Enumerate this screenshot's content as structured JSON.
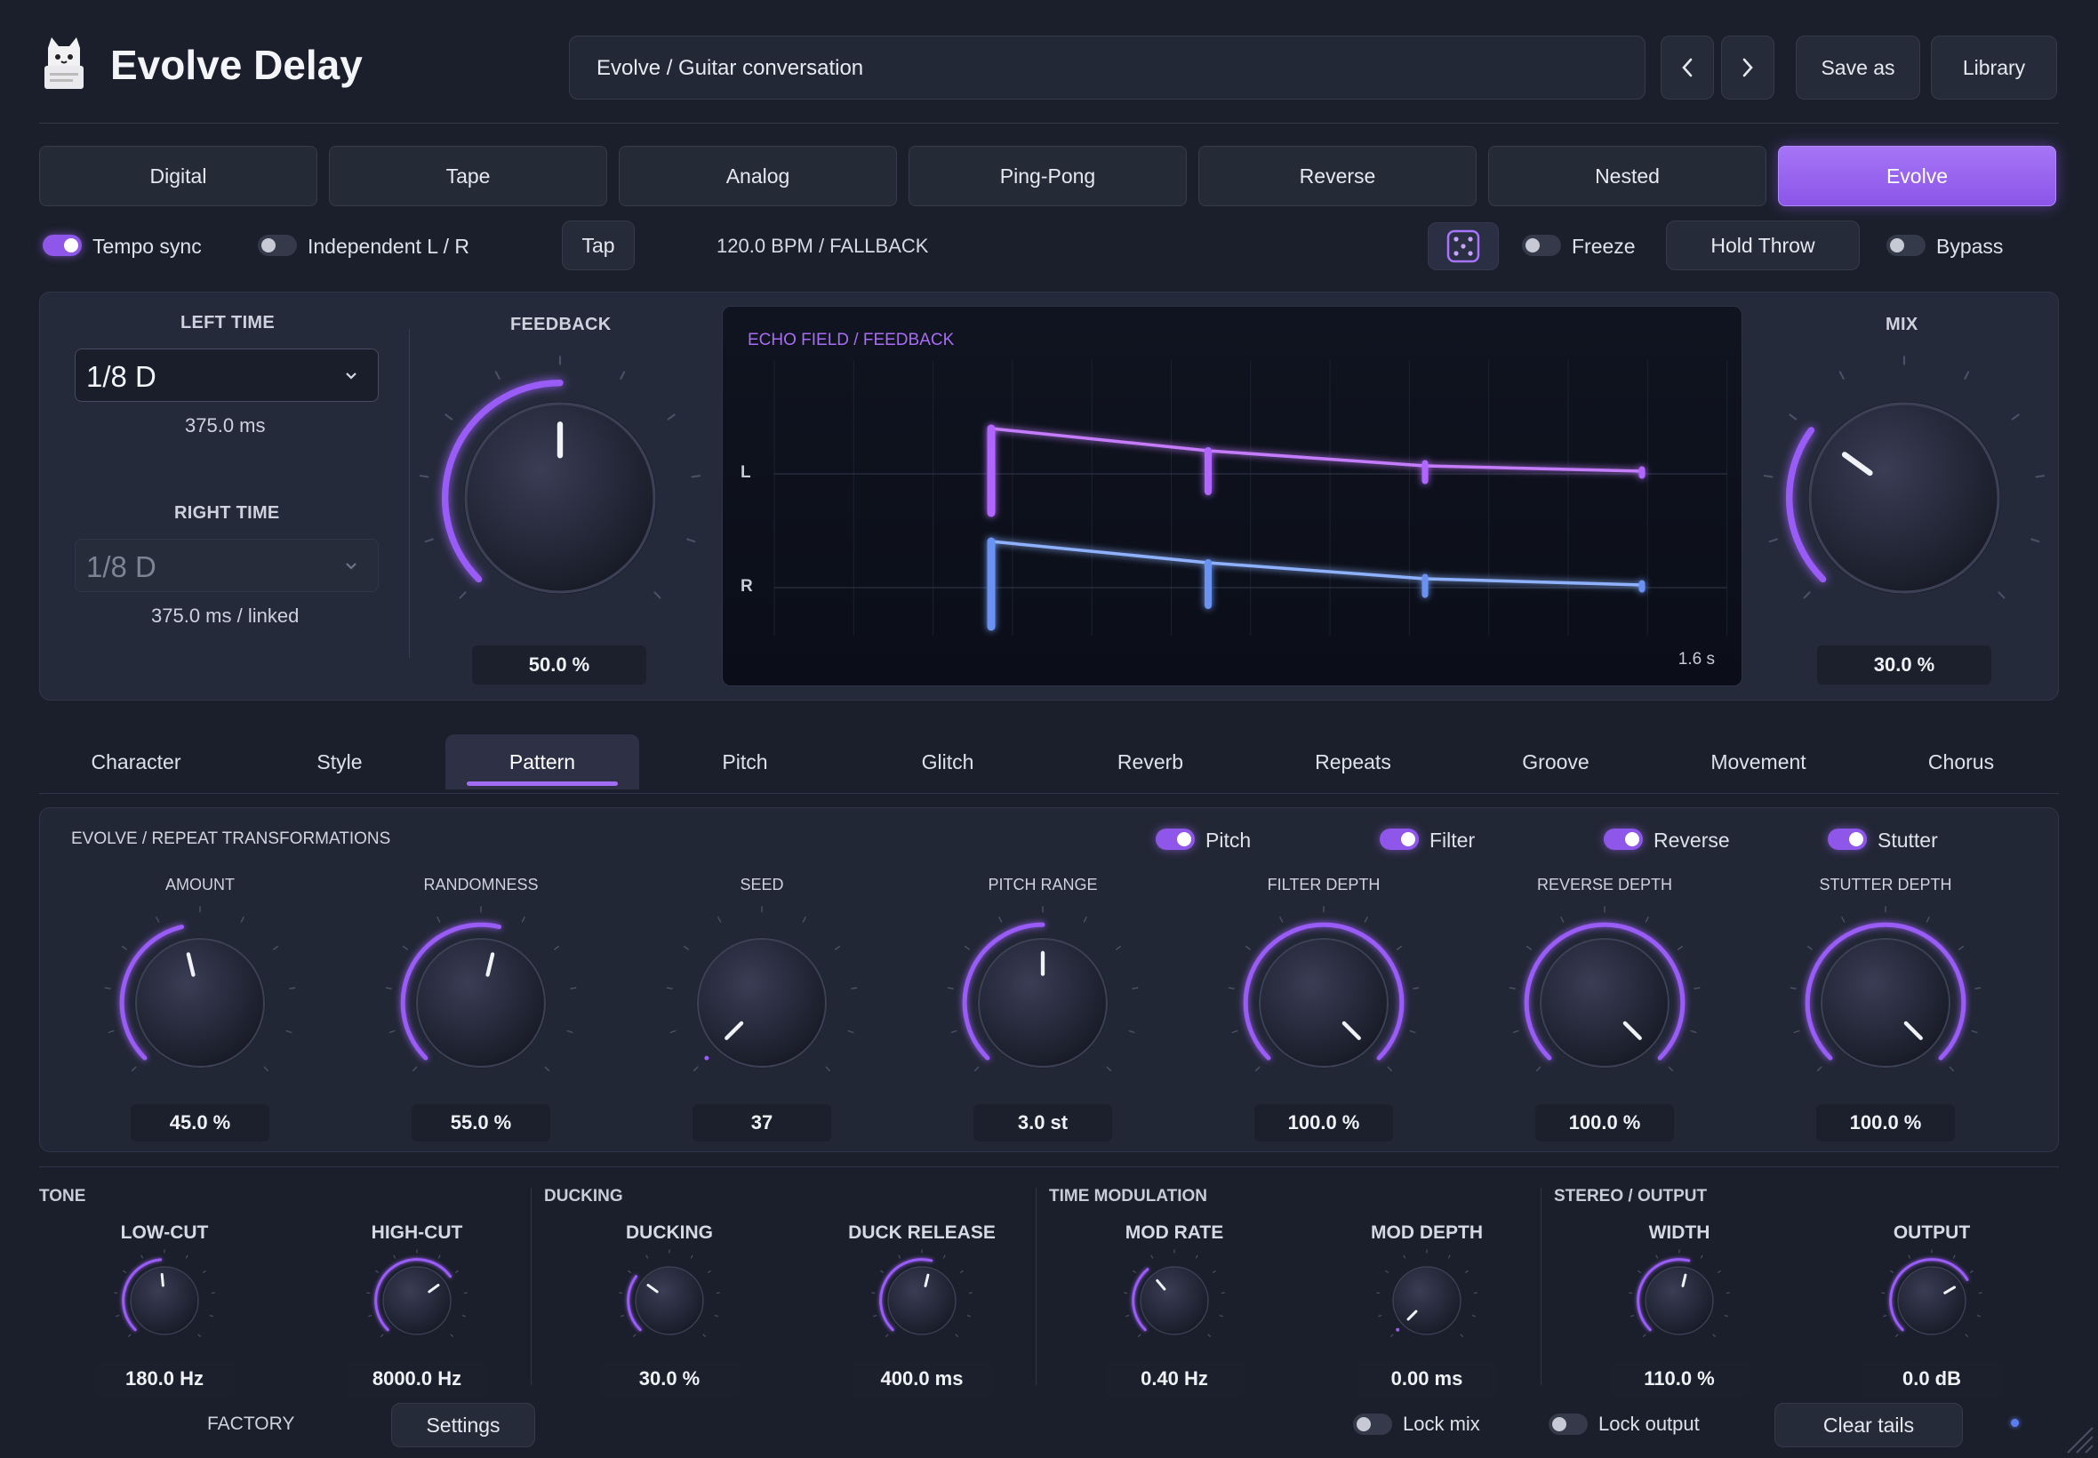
{
  "header": {
    "app_title": "Evolve Delay",
    "preset_name": "Evolve / Guitar conversation",
    "prev_label": "‹",
    "next_label": "›",
    "save_as_label": "Save as",
    "library_label": "Library"
  },
  "modes": [
    "Digital",
    "Tape",
    "Analog",
    "Ping-Pong",
    "Reverse",
    "Nested",
    "Evolve"
  ],
  "active_mode": "Evolve",
  "controls_bar": {
    "tempo_sync": {
      "label": "Tempo sync",
      "on": true
    },
    "independent_lr": {
      "label": "Independent L / R",
      "on": false
    },
    "tap_label": "Tap",
    "bpm_text": "120.0 BPM / FALLBACK",
    "freeze": {
      "label": "Freeze",
      "on": false
    },
    "hold_throw_label": "Hold Throw",
    "bypass": {
      "label": "Bypass",
      "on": false
    }
  },
  "time": {
    "left_title": "LEFT TIME",
    "left_value": "1/8 D",
    "left_ms": "375.0 ms",
    "right_title": "RIGHT TIME",
    "right_value": "1/8 D",
    "right_ms": "375.0 ms / linked"
  },
  "feedback": {
    "title": "FEEDBACK",
    "value_text": "50.0 %",
    "level": 0.5
  },
  "mix": {
    "title": "MIX",
    "value_text": "30.0 %",
    "level": 0.3
  },
  "echo": {
    "title": "ECHO FIELD / FEEDBACK",
    "left_label": "L",
    "right_label": "R",
    "time_label": "1.6 s",
    "colors": {
      "left": "#c57bff",
      "right": "#7ea6ff"
    }
  },
  "sub_tabs": [
    "Character",
    "Style",
    "Pattern",
    "Pitch",
    "Glitch",
    "Reverb",
    "Repeats",
    "Groove",
    "Movement",
    "Chorus"
  ],
  "active_sub_tab": "Pattern",
  "evolve_panel": {
    "title": "EVOLVE / REPEAT TRANSFORMATIONS",
    "toggles": [
      {
        "label": "Pitch",
        "on": true
      },
      {
        "label": "Filter",
        "on": true
      },
      {
        "label": "Reverse",
        "on": true
      },
      {
        "label": "Stutter",
        "on": true
      }
    ],
    "knobs": [
      {
        "label": "AMOUNT",
        "value": "45.0 %",
        "level": 0.45
      },
      {
        "label": "RANDOMNESS",
        "value": "55.0 %",
        "level": 0.55
      },
      {
        "label": "SEED",
        "value": "37",
        "level": 0.0
      },
      {
        "label": "PITCH RANGE",
        "value": "3.0 st",
        "level": 0.5
      },
      {
        "label": "FILTER DEPTH",
        "value": "100.0 %",
        "level": 1.0
      },
      {
        "label": "REVERSE DEPTH",
        "value": "100.0 %",
        "level": 1.0
      },
      {
        "label": "STUTTER DEPTH",
        "value": "100.0 %",
        "level": 1.0
      }
    ]
  },
  "bottom": {
    "sections": [
      "TONE",
      "DUCKING",
      "TIME MODULATION",
      "STEREO / OUTPUT"
    ],
    "knobs": [
      {
        "label": "LOW-CUT",
        "value": "180.0 Hz",
        "level": 0.48
      },
      {
        "label": "HIGH-CUT",
        "value": "8000.0 Hz",
        "level": 0.7
      },
      {
        "label": "DUCKING",
        "value": "30.0 %",
        "level": 0.3
      },
      {
        "label": "DUCK RELEASE",
        "value": "400.0 ms",
        "level": 0.55
      },
      {
        "label": "MOD RATE",
        "value": "0.40 Hz",
        "level": 0.35
      },
      {
        "label": "MOD DEPTH",
        "value": "0.00 ms",
        "level": 0.0
      },
      {
        "label": "WIDTH",
        "value": "110.0 %",
        "level": 0.55
      },
      {
        "label": "OUTPUT",
        "value": "0.0 dB",
        "level": 0.72
      }
    ]
  },
  "footer": {
    "factory_label": "FACTORY",
    "settings_label": "Settings",
    "lock_mix": {
      "label": "Lock mix",
      "on": false
    },
    "lock_output": {
      "label": "Lock output",
      "on": false
    },
    "clear_tails_label": "Clear tails"
  }
}
